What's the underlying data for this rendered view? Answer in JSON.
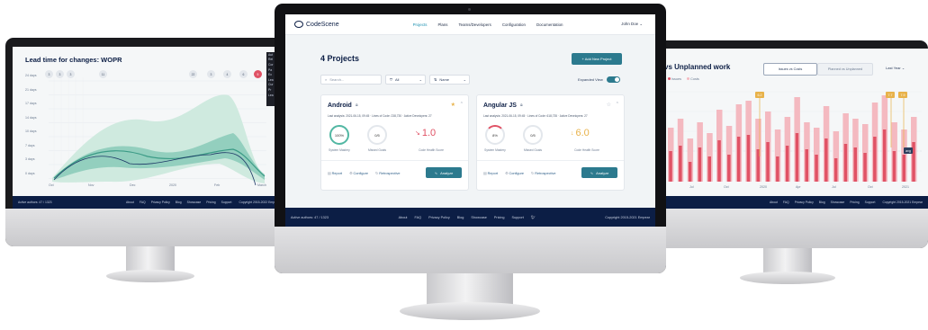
{
  "left": {
    "title": "Lead time for changes: WOPR",
    "y_labels": [
      "24 days",
      "21 days",
      "17 days",
      "14 days",
      "10 days",
      "7 days",
      "3 days",
      "0 days"
    ],
    "x_labels": [
      "Oct",
      "Nov",
      "Dec",
      "2020",
      "Feb",
      "March"
    ],
    "top_markers_a": [
      "3",
      "3",
      "3",
      "11"
    ],
    "top_markers_b": [
      "22",
      "3",
      "4",
      "6",
      "5"
    ],
    "legend_items": [
      "Aut",
      "Rel",
      "Cor",
      "Pa",
      "Ex",
      "Lea",
      "Cur",
      "Pr",
      "Lea"
    ],
    "footer_left": "Active authors: 47 / 1323",
    "footer_links": [
      "About",
      "FAQ",
      "Privacy Policy",
      "Blog",
      "Showcase",
      "Pricing",
      "Support"
    ],
    "footer_right": "Copyright 2015-2022 Empear"
  },
  "center": {
    "brand": "CodeScene",
    "nav": [
      "Projects",
      "Plans",
      "Teams/Developers",
      "Configuration",
      "Documentation"
    ],
    "user": "John Doe",
    "heading": "4 Projects",
    "add_button": "+ Add New Project",
    "search_placeholder": "Search...",
    "filter_value": "All",
    "sort_value": "Name",
    "expanded_view": "Expanded View",
    "projects": [
      {
        "name": "Android",
        "meta": "Last analysis: 2021-06-15, 09:45  ·  Lines of Code: 238,730  ·  Active Developers: 27",
        "system_mastery": "100%",
        "system_mastery_label": "System Mastery",
        "missed_goals": "0/5",
        "missed_goals_label": "Missed Goals",
        "health": "1.0",
        "health_label": "Code Health Score",
        "arrow": "↘",
        "report": "Report",
        "configure": "Configure",
        "retrospective": "Retrospective",
        "analyze": "Analyze"
      },
      {
        "name": "Angular JS",
        "meta": "Last analysis: 2021-06-15, 09:45  ·  Lines of Code: 618,735  ·  Active Developers: 27",
        "system_mastery": "8%",
        "system_mastery_label": "System Mastery",
        "missed_goals": "0/5",
        "missed_goals_label": "Missed Goals",
        "health": "6.0",
        "health_label": "Code Health Score",
        "arrow": "↓",
        "report": "Report",
        "configure": "Configure",
        "retrospective": "Retrospective",
        "analyze": "Analyze"
      }
    ],
    "footer_left": "Active authors: 47 / 1323",
    "footer_links": [
      "About",
      "FAQ",
      "Privacy Policy",
      "Blog",
      "Showcase",
      "Pricing",
      "Support"
    ],
    "footer_right": "Copyright 2015-2021 Empear"
  },
  "right": {
    "title": "vs Unplanned work",
    "tab_a": "Issues vs Costs",
    "tab_b": "Planned vs Unplanned",
    "period": "Last Year",
    "legend_issues": "Issues",
    "legend_costs": "Costs",
    "badge_a": "6.2",
    "badge_b": "7.7",
    "badge_c": "7.9",
    "avg": "avg",
    "x_labels": [
      "Jul",
      "Oct",
      "2020",
      "Apr",
      "Jul",
      "Oct",
      "2021"
    ],
    "footer_links": [
      "About",
      "FAQ",
      "Privacy Policy",
      "Blog",
      "Showcase",
      "Pricing",
      "Support"
    ],
    "footer_right": "Copyright 2015-2021 Empear",
    "colors": {
      "issues": "#e05265",
      "costs": "#f4b9c0",
      "badge": "#e8b24a"
    }
  }
}
